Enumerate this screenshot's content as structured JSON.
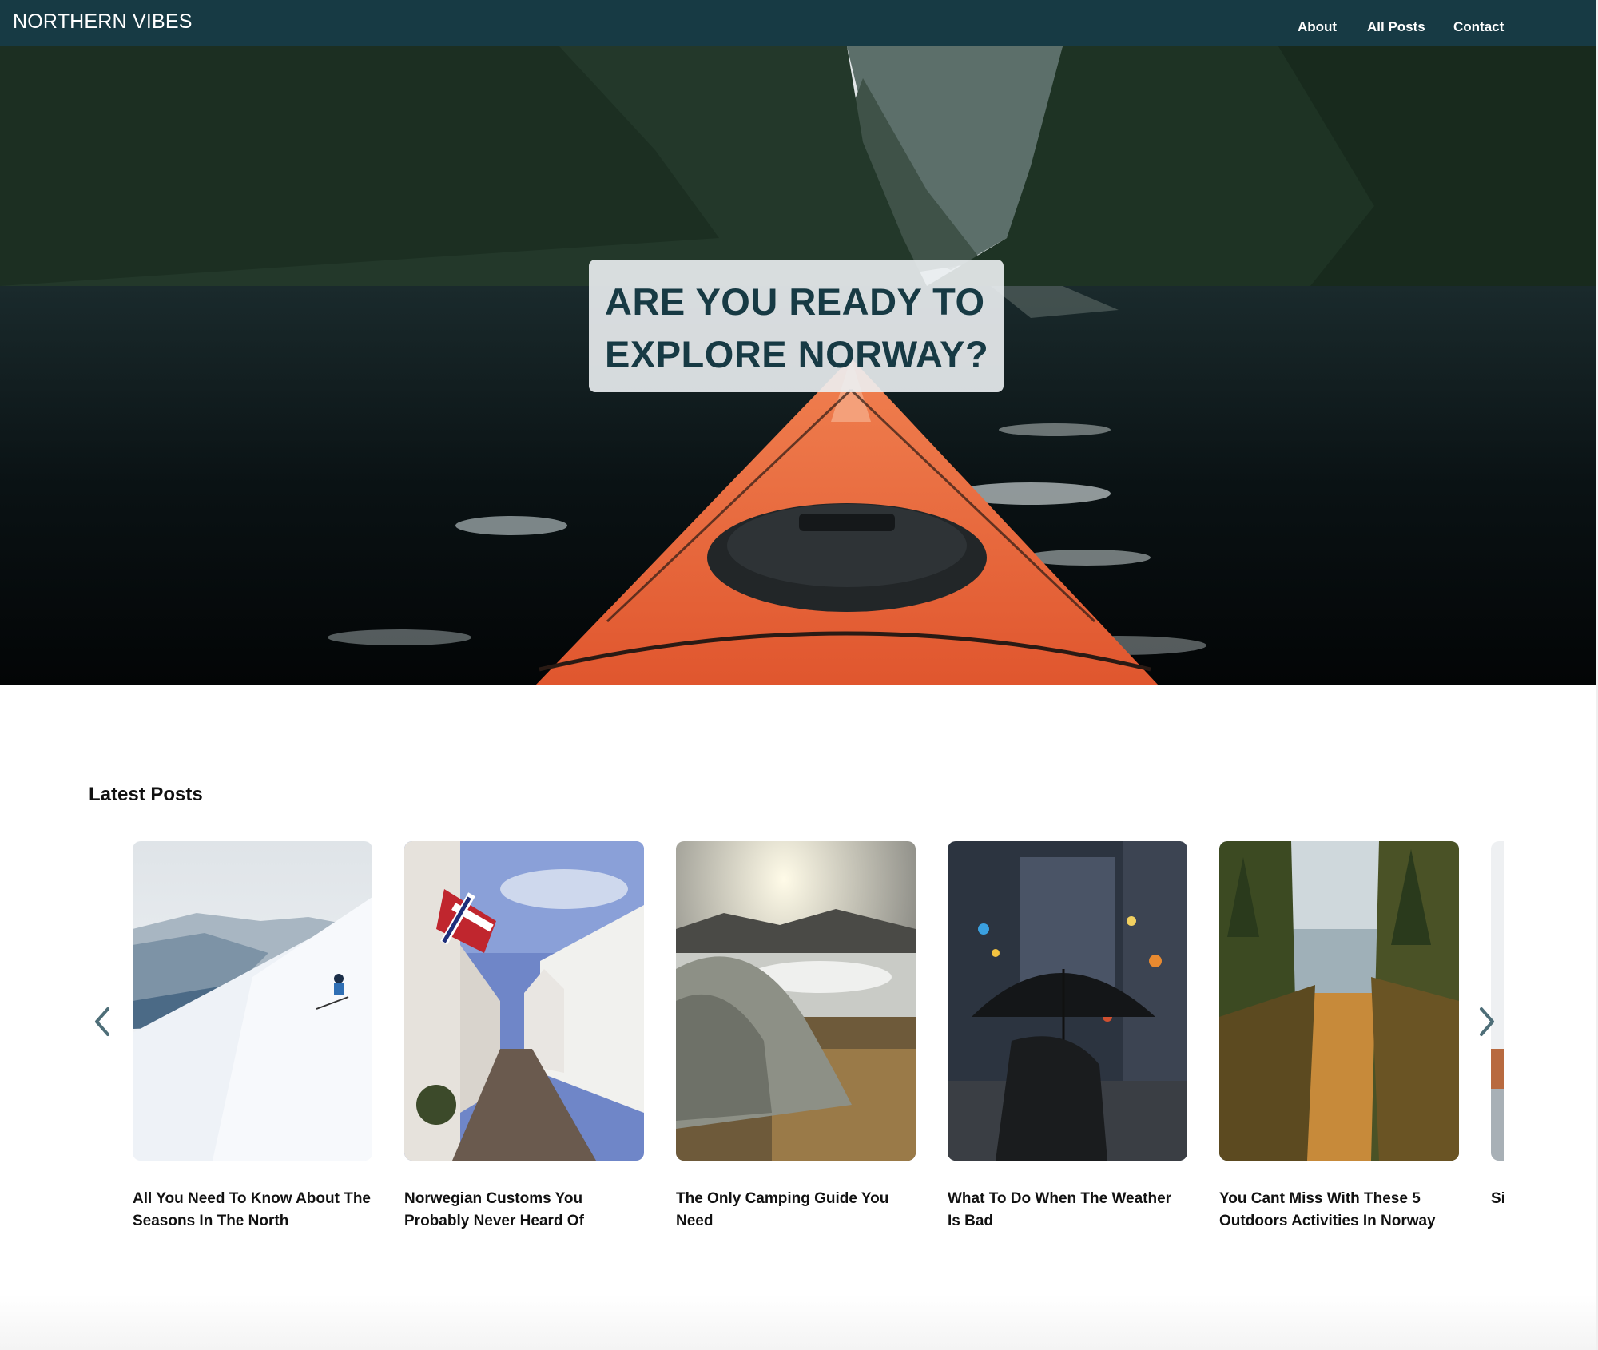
{
  "header": {
    "brand": "NORTHERN VIBES",
    "nav": [
      "About",
      "All Posts",
      "Contact"
    ],
    "background": "#173a44"
  },
  "hero": {
    "title": "ARE YOU READY TO EXPLORE NORWAY?",
    "image": "kayak-fjord-photo"
  },
  "latest": {
    "heading": "Latest Posts",
    "posts": [
      {
        "title": "All You Need To Know About The Seasons In The North",
        "image": "skier-snow-photo"
      },
      {
        "title": "Norwegian Customs You Probably Never Heard Of",
        "image": "street-flag-photo"
      },
      {
        "title": "The Only Camping Guide You Need",
        "image": "tent-lake-photo"
      },
      {
        "title": "What To Do When The Weather Is Bad",
        "image": "umbrella-rain-photo"
      },
      {
        "title": "You Cant Miss With These 5 Outdoors Activities In Norway",
        "image": "forest-cliff-photo"
      },
      {
        "title": "Si",
        "image": "partial-card-photo"
      }
    ],
    "prev_icon": "chevron-left-icon",
    "next_icon": "chevron-right-icon"
  }
}
